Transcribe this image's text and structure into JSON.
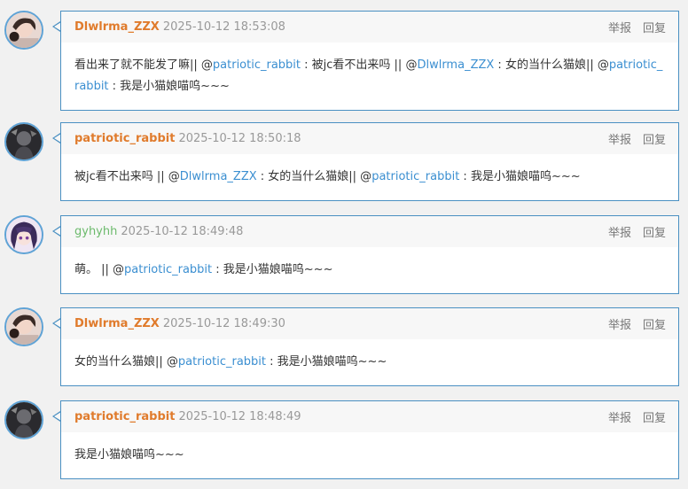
{
  "labels": {
    "report": "举报",
    "reply": "回复"
  },
  "comments": [
    {
      "author": "Dlwlrma_ZZX",
      "time": "2025-10-12 18:53:08",
      "avatar": "girl-portrait",
      "body": [
        {
          "t": "看出来了就不能发了嘛|| @"
        },
        {
          "m": "patriotic_rabbit"
        },
        {
          "t": " : 被jc看不出来吗 || @"
        },
        {
          "m": "Dlwlrma_ZZX"
        },
        {
          "t": " : 女的当什么猫娘|| @"
        },
        {
          "m": "patriotic_rabbit"
        },
        {
          "t": " : 我是小猫娘喵呜~~~"
        }
      ]
    },
    {
      "author": "patriotic_rabbit",
      "time": "2025-10-12 18:50:18",
      "avatar": "dark-figure",
      "body": [
        {
          "t": "被jc看不出来吗 || @"
        },
        {
          "m": "Dlwlrma_ZZX"
        },
        {
          "t": " : 女的当什么猫娘|| @"
        },
        {
          "m": "patriotic_rabbit"
        },
        {
          "t": " : 我是小猫娘喵呜~~~"
        }
      ]
    },
    {
      "author": "gyhyhh",
      "time": "2025-10-12 18:49:48",
      "avatar": "anime-girl",
      "body": [
        {
          "t": "萌。 || @"
        },
        {
          "m": "patriotic_rabbit"
        },
        {
          "t": " : 我是小猫娘喵呜~~~"
        }
      ]
    },
    {
      "author": "Dlwlrma_ZZX",
      "time": "2025-10-12 18:49:30",
      "avatar": "girl-portrait",
      "body": [
        {
          "t": "女的当什么猫娘|| @"
        },
        {
          "m": "patriotic_rabbit"
        },
        {
          "t": " : 我是小猫娘喵呜~~~"
        }
      ]
    },
    {
      "author": "patriotic_rabbit",
      "time": "2025-10-12 18:48:49",
      "avatar": "dark-figure",
      "body": [
        {
          "t": "我是小猫娘喵呜~~~"
        }
      ]
    }
  ],
  "colors": {
    "accent": "#4a90c2",
    "author": "#e07b2c",
    "author_alt": "#6cba6c",
    "mention": "#3b8fd1"
  }
}
